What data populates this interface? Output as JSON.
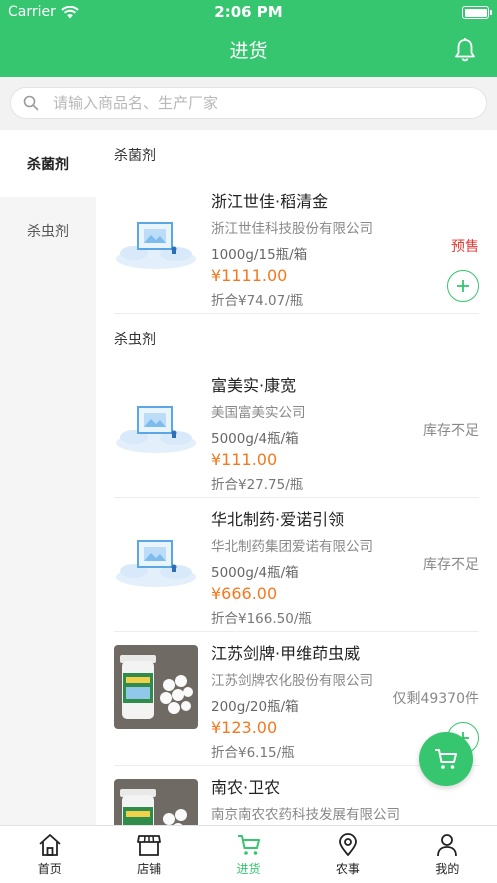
{
  "status_bar": {
    "carrier": "Carrier",
    "time": "2:06 PM"
  },
  "header": {
    "title": "进货"
  },
  "search": {
    "placeholder": "请输入商品名、生产厂家"
  },
  "sidebar": {
    "items": [
      {
        "label": "杀菌剂",
        "active": true
      },
      {
        "label": "杀虫剂",
        "active": false
      }
    ]
  },
  "sections": [
    {
      "title": "杀菌剂",
      "products": [
        {
          "name": "浙江世佳·稻清金",
          "company": "浙江世佳科技股份有限公司",
          "spec": "1000g/15瓶/箱",
          "price": "¥1111.00",
          "unit_price": "折合¥74.07/瓶",
          "badge": "预售"
        }
      ]
    },
    {
      "title": "杀虫剂",
      "products": [
        {
          "name": "富美实·康宽",
          "company": "美国富美实公司",
          "spec": "5000g/4瓶/箱",
          "price": "¥111.00",
          "unit_price": "折合¥27.75/瓶",
          "badge": "库存不足"
        },
        {
          "name": "华北制药·爱诺引领",
          "company": "华北制药集团爱诺有限公司",
          "spec": "5000g/4瓶/箱",
          "price": "¥666.00",
          "unit_price": "折合¥166.50/瓶",
          "badge": "库存不足"
        },
        {
          "name": "江苏剑牌·甲维茚虫威",
          "company": "江苏剑牌农化股份有限公司",
          "spec": "200g/20瓶/箱",
          "price": "¥123.00",
          "unit_price": "折合¥6.15/瓶",
          "badge": "仅剩49370件"
        },
        {
          "name": "南农·卫农",
          "company": "南京南农农药科技发展有限公司",
          "spec": "",
          "price": "",
          "unit_price": "",
          "badge": ""
        }
      ]
    }
  ],
  "tabbar": [
    {
      "label": "首页",
      "icon": "home-icon"
    },
    {
      "label": "店铺",
      "icon": "store-icon"
    },
    {
      "label": "进货",
      "icon": "cart-icon",
      "active": true
    },
    {
      "label": "农事",
      "icon": "location-icon"
    },
    {
      "label": "我的",
      "icon": "user-icon"
    }
  ],
  "colors": {
    "brand": "#35c66f",
    "price": "#f5781e",
    "presale": "#e53935"
  }
}
